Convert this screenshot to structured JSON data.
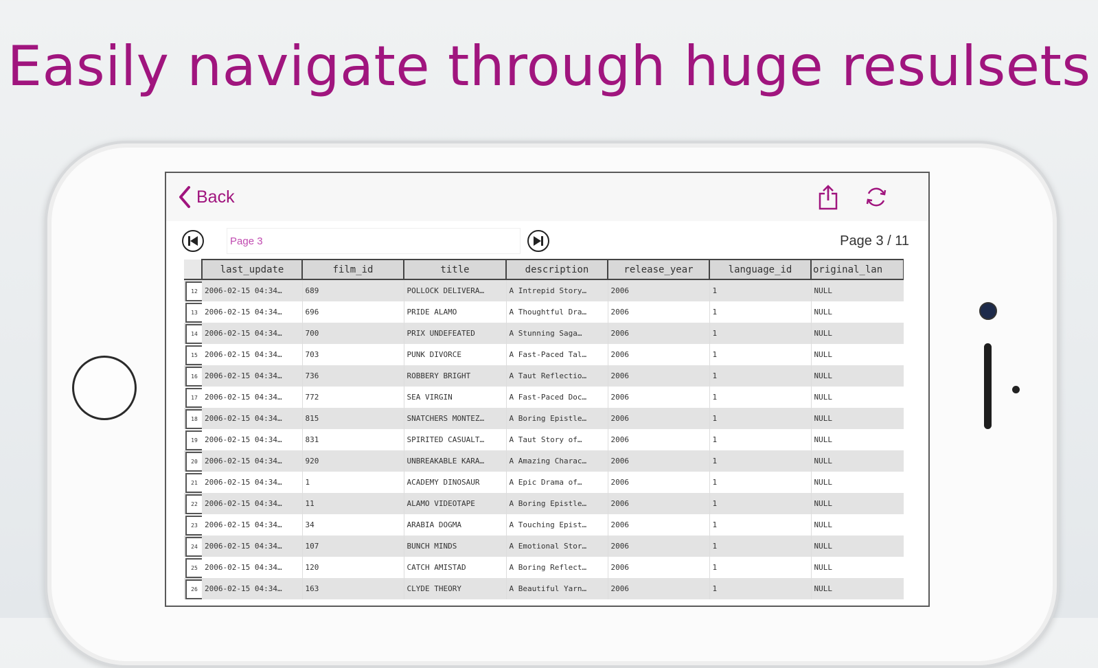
{
  "headline": "Easily navigate through huge resulsets",
  "nav": {
    "back_label": "Back",
    "share_icon": "share-icon",
    "refresh_icon": "refresh-icon",
    "accent": "#a0157e"
  },
  "pager": {
    "page_placeholder": "Page 3",
    "page_indicator": "Page 3 / 11"
  },
  "table": {
    "columns": [
      "last_update",
      "film_id",
      "title",
      "description",
      "release_year",
      "language_id",
      "original_lan"
    ],
    "rows": [
      {
        "n": "12",
        "c": [
          "2006-02-15 04:34…",
          "689",
          "POLLOCK DELIVERA…",
          "A Intrepid Story…",
          "2006",
          "1",
          "NULL"
        ]
      },
      {
        "n": "13",
        "c": [
          "2006-02-15 04:34…",
          "696",
          "PRIDE ALAMO",
          "A Thoughtful Dra…",
          "2006",
          "1",
          "NULL"
        ]
      },
      {
        "n": "14",
        "c": [
          "2006-02-15 04:34…",
          "700",
          "PRIX UNDEFEATED",
          "A Stunning Saga…",
          "2006",
          "1",
          "NULL"
        ]
      },
      {
        "n": "15",
        "c": [
          "2006-02-15 04:34…",
          "703",
          "PUNK DIVORCE",
          "A Fast-Paced Tal…",
          "2006",
          "1",
          "NULL"
        ]
      },
      {
        "n": "16",
        "c": [
          "2006-02-15 04:34…",
          "736",
          "ROBBERY BRIGHT",
          "A Taut Reflectio…",
          "2006",
          "1",
          "NULL"
        ]
      },
      {
        "n": "17",
        "c": [
          "2006-02-15 04:34…",
          "772",
          "SEA VIRGIN",
          "A Fast-Paced Doc…",
          "2006",
          "1",
          "NULL"
        ]
      },
      {
        "n": "18",
        "c": [
          "2006-02-15 04:34…",
          "815",
          "SNATCHERS MONTEZ…",
          "A Boring Epistle…",
          "2006",
          "1",
          "NULL"
        ]
      },
      {
        "n": "19",
        "c": [
          "2006-02-15 04:34…",
          "831",
          "SPIRITED CASUALT…",
          "A Taut Story of…",
          "2006",
          "1",
          "NULL"
        ]
      },
      {
        "n": "20",
        "c": [
          "2006-02-15 04:34…",
          "920",
          "UNBREAKABLE KARA…",
          "A Amazing Charac…",
          "2006",
          "1",
          "NULL"
        ]
      },
      {
        "n": "21",
        "c": [
          "2006-02-15 04:34…",
          "1",
          "ACADEMY DINOSAUR",
          "A Epic Drama of…",
          "2006",
          "1",
          "NULL"
        ]
      },
      {
        "n": "22",
        "c": [
          "2006-02-15 04:34…",
          "11",
          "ALAMO VIDEOTAPE",
          "A Boring Epistle…",
          "2006",
          "1",
          "NULL"
        ]
      },
      {
        "n": "23",
        "c": [
          "2006-02-15 04:34…",
          "34",
          "ARABIA DOGMA",
          "A Touching Epist…",
          "2006",
          "1",
          "NULL"
        ]
      },
      {
        "n": "24",
        "c": [
          "2006-02-15 04:34…",
          "107",
          "BUNCH MINDS",
          "A Emotional Stor…",
          "2006",
          "1",
          "NULL"
        ]
      },
      {
        "n": "25",
        "c": [
          "2006-02-15 04:34…",
          "120",
          "CATCH AMISTAD",
          "A Boring Reflect…",
          "2006",
          "1",
          "NULL"
        ]
      },
      {
        "n": "26",
        "c": [
          "2006-02-15 04:34…",
          "163",
          "CLYDE THEORY",
          "A Beautiful Yarn…",
          "2006",
          "1",
          "NULL"
        ]
      }
    ]
  }
}
